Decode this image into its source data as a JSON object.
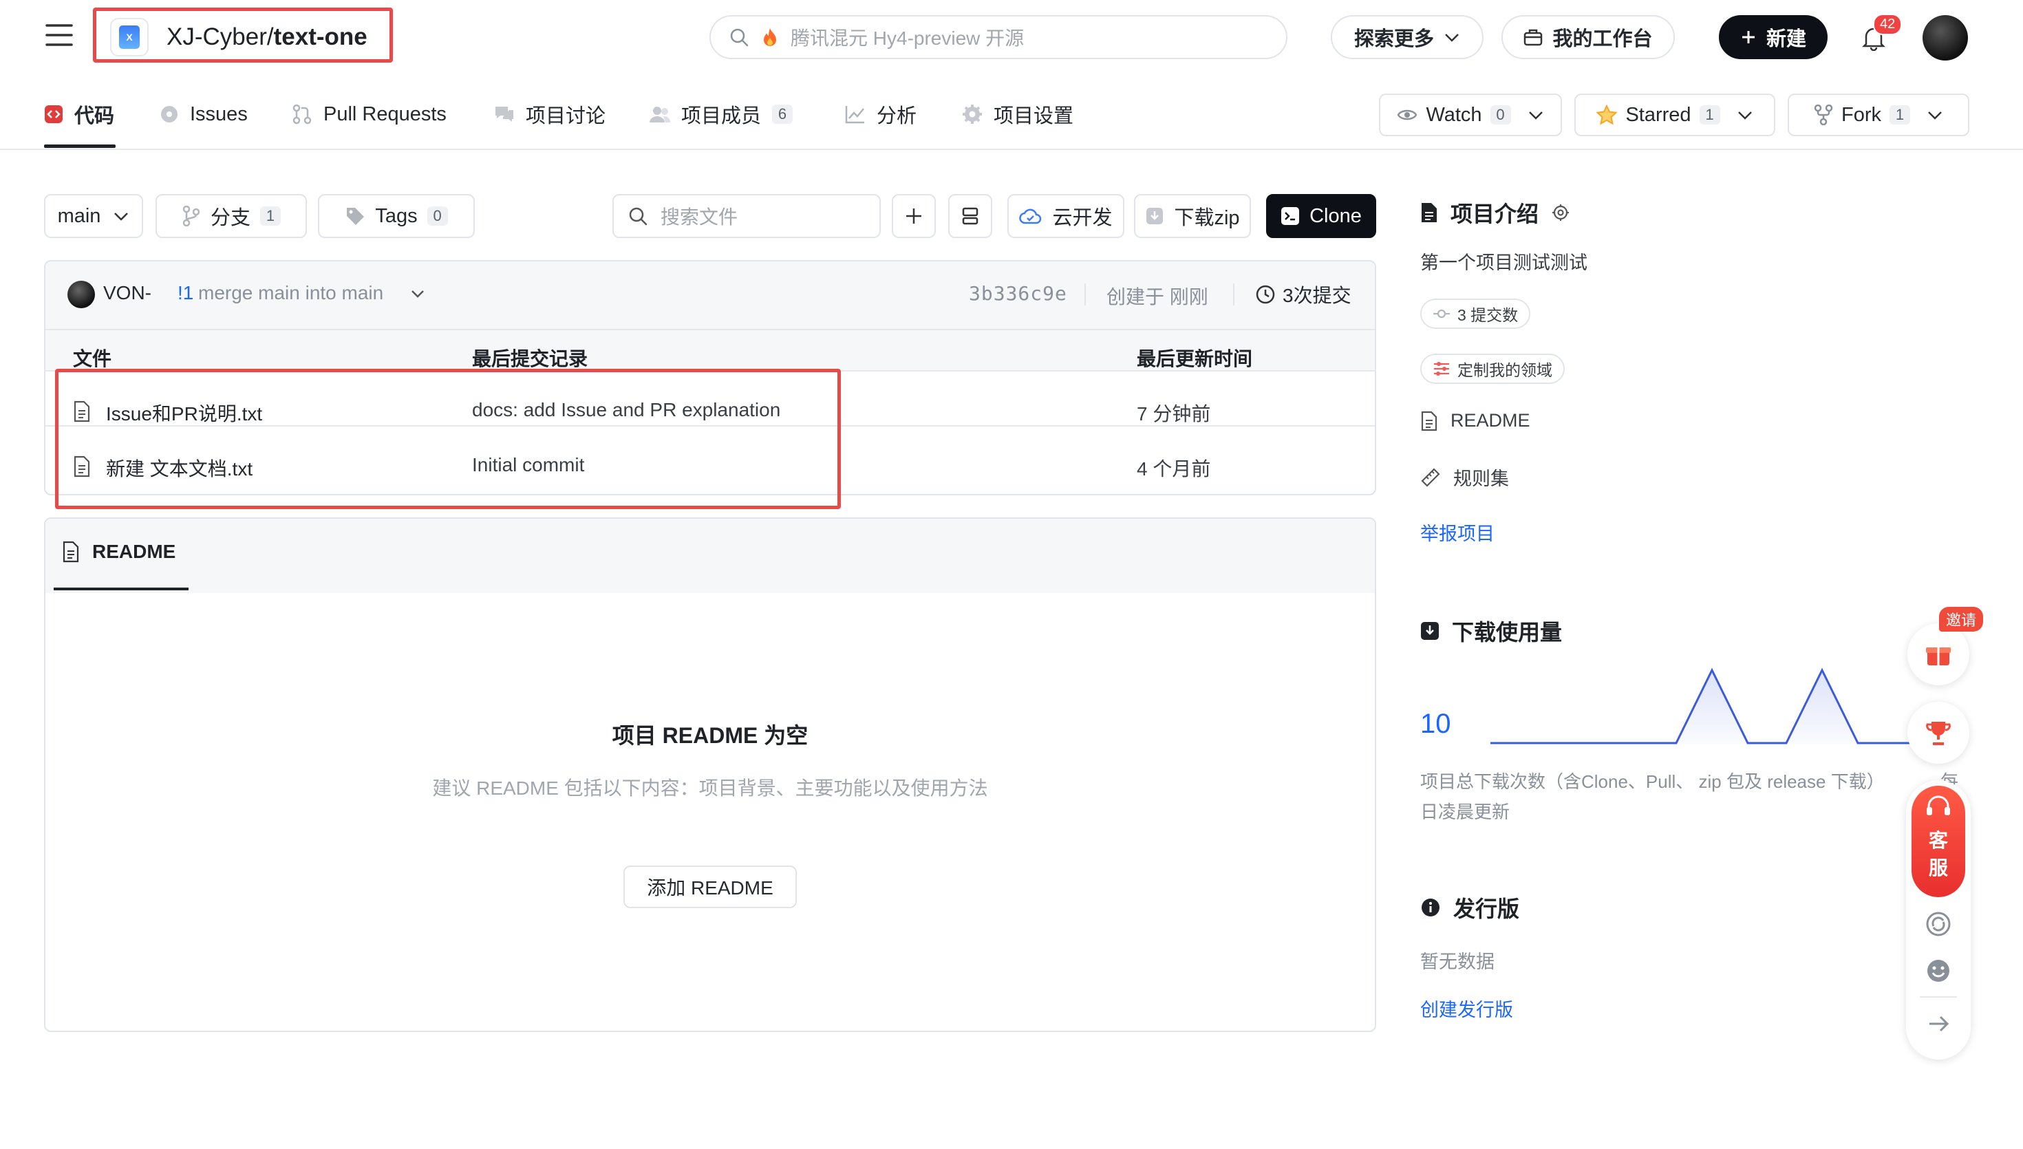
{
  "header": {
    "repo_owner": "XJ-Cyber",
    "repo_sep": "/",
    "repo_name": "text-one",
    "search_placeholder": "腾讯混元 Hy4-preview 开源",
    "explore_label": "探索更多",
    "workbench_label": "我的工作台",
    "new_label": "新建",
    "notification_count": "42"
  },
  "tabs": [
    {
      "label": "代码",
      "active": true
    },
    {
      "label": "Issues"
    },
    {
      "label": "Pull Requests"
    },
    {
      "label": "项目讨论"
    },
    {
      "label": "项目成员",
      "count": "6"
    },
    {
      "label": "分析"
    },
    {
      "label": "项目设置"
    }
  ],
  "repo_actions": {
    "watch_label": "Watch",
    "watch_count": "0",
    "star_label": "Starred",
    "star_count": "1",
    "fork_label": "Fork",
    "fork_count": "1"
  },
  "toolbar": {
    "branch": "main",
    "branches_label": "分支",
    "branches_count": "1",
    "tags_label": "Tags",
    "tags_count": "0",
    "file_search_placeholder": "搜索文件",
    "cloud_dev_label": "云开发",
    "download_zip_label": "下载zip",
    "clone_label": "Clone"
  },
  "commit_bar": {
    "author": "VON-",
    "pr_ref": "!1",
    "message": "merge main into main",
    "hash": "3b336c9e",
    "created": "创建于 刚刚",
    "commits_count": "3次提交"
  },
  "file_table": {
    "headers": [
      "文件",
      "最后提交记录",
      "最后更新时间"
    ],
    "rows": [
      {
        "name": "Issue和PR说明.txt",
        "commit": "docs: add Issue and PR explanation",
        "time": "7 分钟前"
      },
      {
        "name": "新建 文本文档.txt",
        "commit": "Initial commit",
        "time": "4 个月前"
      }
    ]
  },
  "readme": {
    "tab_label": "README",
    "empty_title": "项目 README 为空",
    "empty_hint": "建议 README 包括以下内容：项目背景、主要功能以及使用方法",
    "add_button": "添加 README"
  },
  "sidebar": {
    "intro_title": "项目介绍",
    "description": "第一个项目测试测试",
    "commits_pill": "3 提交数",
    "custom_domain_pill": "定制我的领域",
    "readme_link": "README",
    "rules_link": "规则集",
    "report_link": "举报项目",
    "downloads_title": "下载使用量",
    "downloads_value": "10",
    "downloads_note": "项目总下载次数（含Clone、Pull、 zip 包及 release 下载）",
    "downloads_update": "日凌晨更新",
    "releases_title": "发行版",
    "releases_empty": "暂无数据",
    "create_release": "创建发行版"
  },
  "floating": {
    "invite_label": "邀请",
    "service_label_1": "客",
    "service_label_2": "服",
    "note_tail": "每"
  },
  "colors": {
    "accent": "#1a66ff",
    "highlight_box": "#e84a4a",
    "code_tab_icon": "#e03c3c",
    "star": "#f5a623"
  }
}
